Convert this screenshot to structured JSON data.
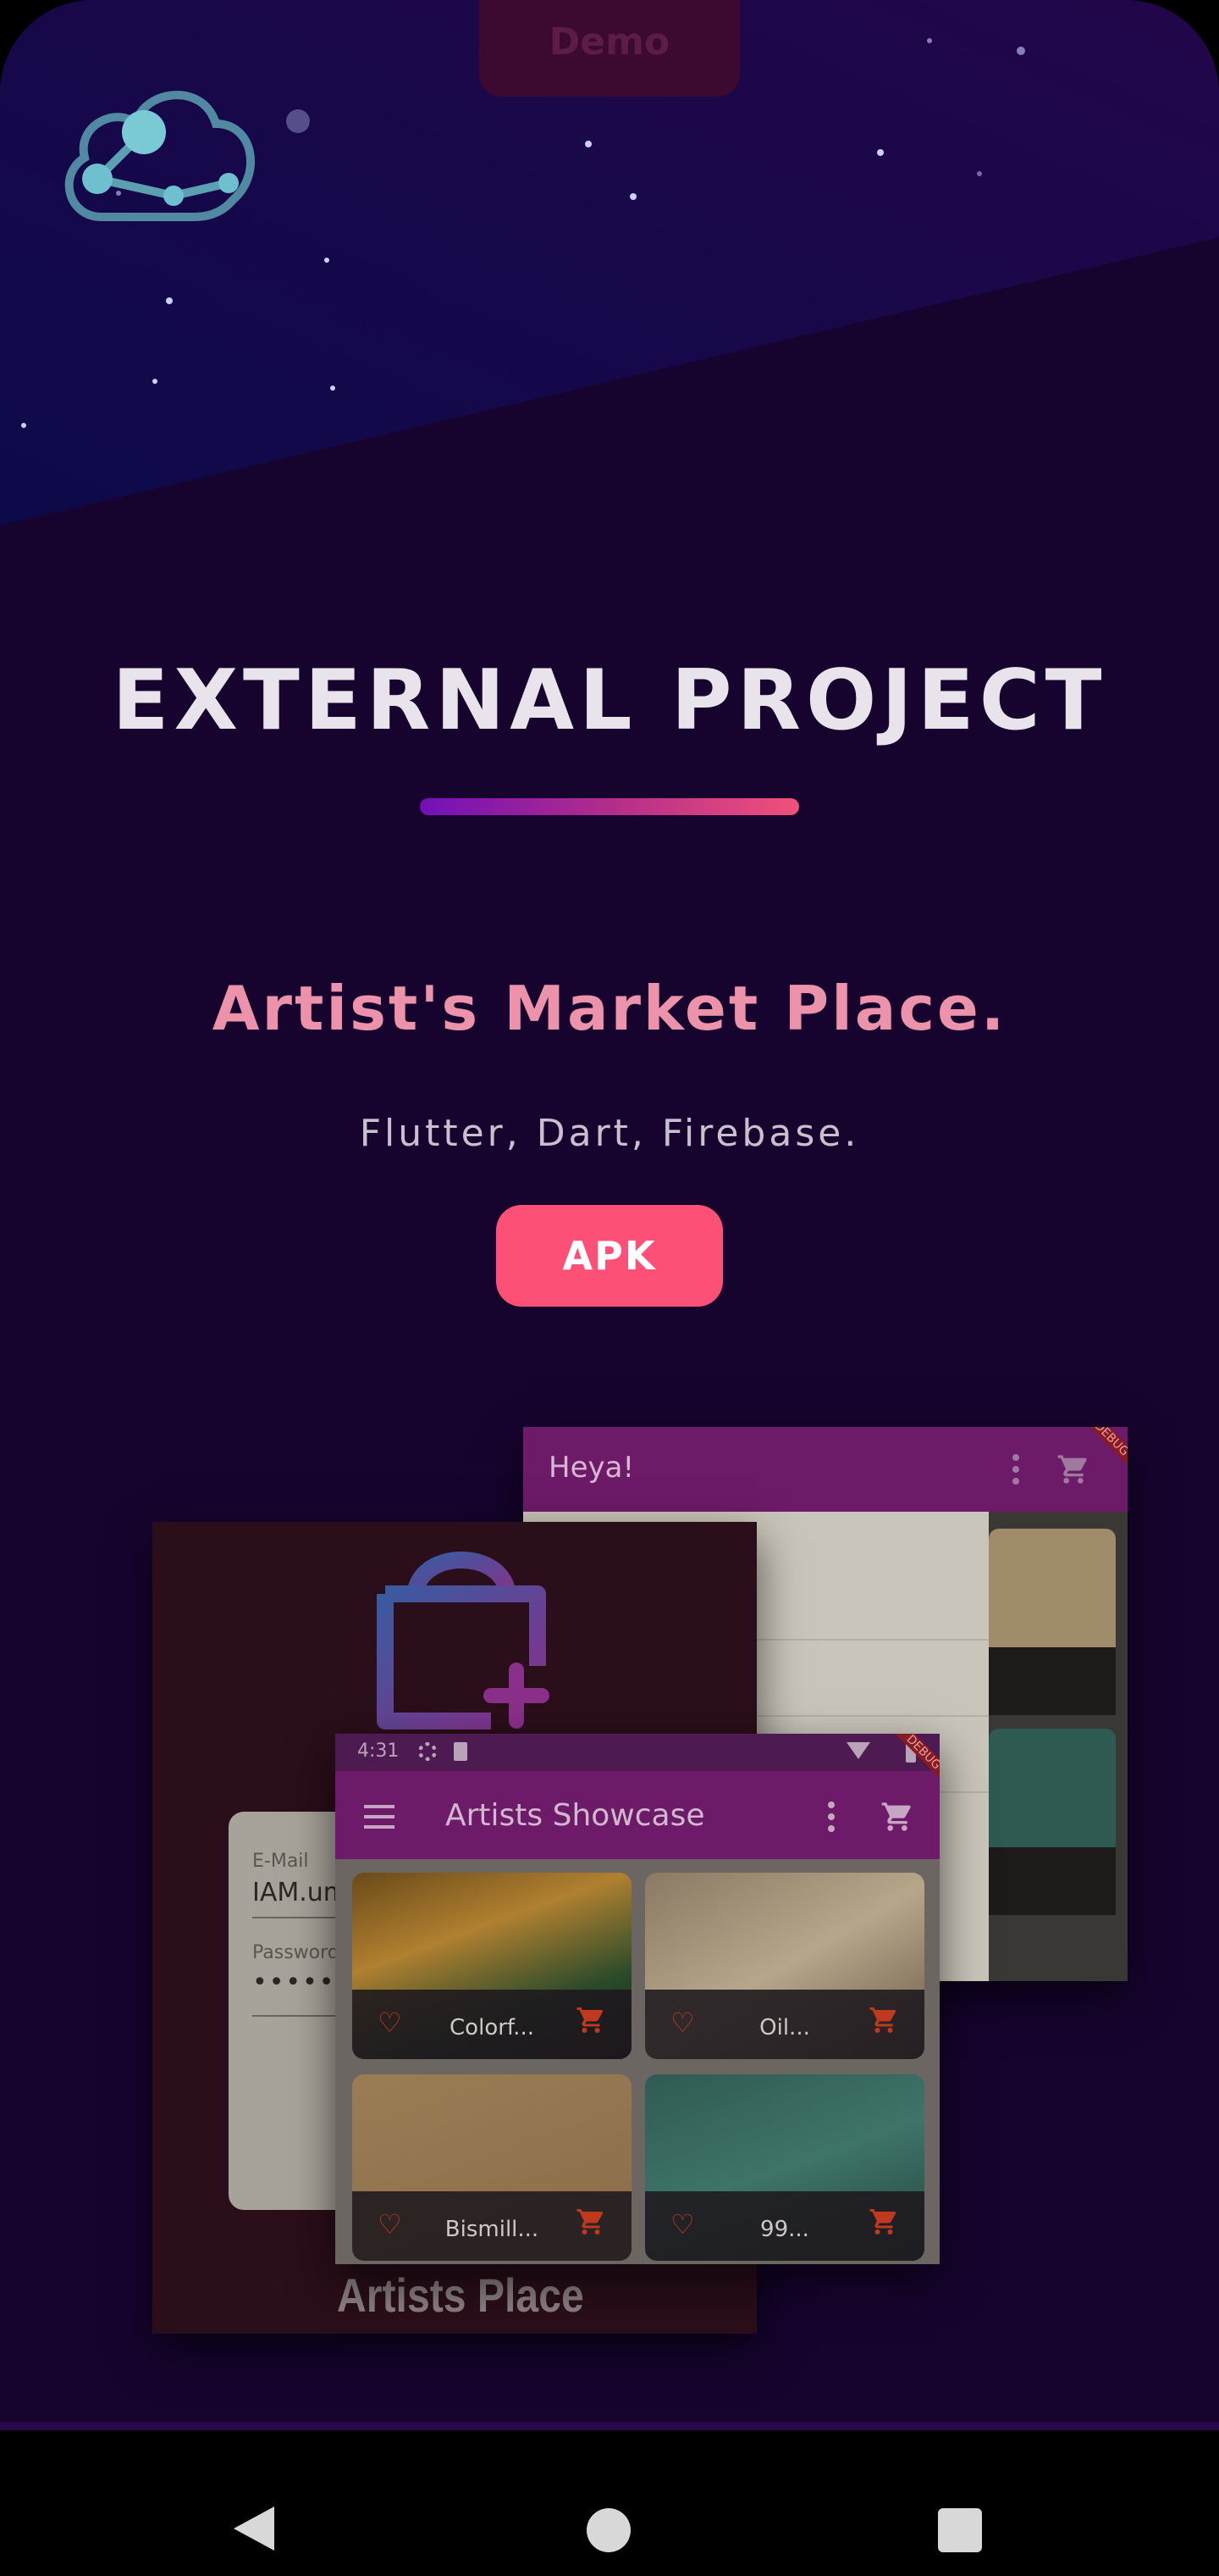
{
  "header": {
    "demo_label": "Demo"
  },
  "section": {
    "title": "EXTERNAL PROJECT",
    "project_name": "Artist's Market Place.",
    "tech_stack": "Flutter, Dart, Firebase.",
    "apk_label": "APK"
  },
  "screenshots": {
    "back": {
      "title": "Heya!",
      "badge": "DEBUG"
    },
    "login": {
      "email_label": "E-Mail",
      "email_value": "IAM.um",
      "password_label": "Password",
      "password_value": "••••••",
      "brand": "Artists Place"
    },
    "main": {
      "status_time": "4:31",
      "badge": "DEBUG",
      "app_title": "Artists Showcase",
      "cards": [
        {
          "label": "Colorf..."
        },
        {
          "label": "Oil..."
        },
        {
          "label": "Bismill..."
        },
        {
          "label": "99..."
        }
      ]
    }
  },
  "colors": {
    "accent": "#fd5077",
    "background": "#16042e",
    "subtitle": "#ec93ab"
  },
  "icons": [
    "cloud-network-logo-icon",
    "back-nav-icon",
    "home-nav-icon",
    "recents-nav-icon",
    "menu-icon",
    "more-vert-icon",
    "cart-icon",
    "heart-icon",
    "shopping-bag-add-icon"
  ]
}
